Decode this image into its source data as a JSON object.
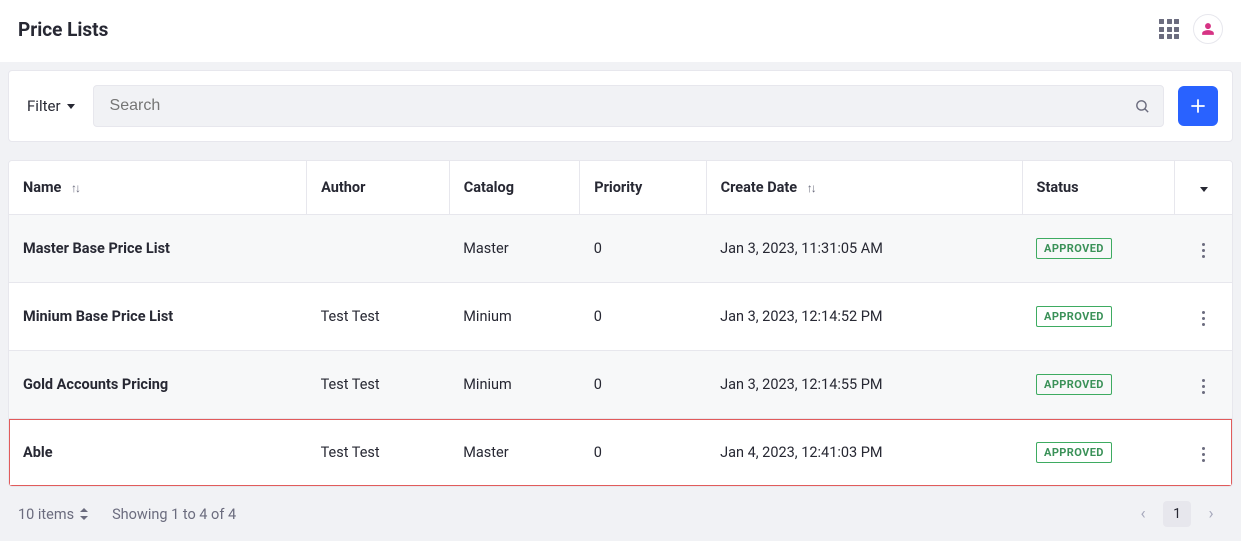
{
  "header": {
    "title": "Price Lists"
  },
  "toolbar": {
    "filter_label": "Filter",
    "search_placeholder": "Search",
    "add_label": "+"
  },
  "table": {
    "columns": {
      "name": "Name",
      "author": "Author",
      "catalog": "Catalog",
      "priority": "Priority",
      "created": "Create Date",
      "status": "Status"
    },
    "rows": [
      {
        "name": "Master Base Price List",
        "author": "",
        "catalog": "Master",
        "priority": "0",
        "created": "Jan 3, 2023, 11:31:05 AM",
        "status": "APPROVED",
        "highlighted": false
      },
      {
        "name": "Minium Base Price List",
        "author": "Test Test",
        "catalog": "Minium",
        "priority": "0",
        "created": "Jan 3, 2023, 12:14:52 PM",
        "status": "APPROVED",
        "highlighted": false
      },
      {
        "name": "Gold Accounts Pricing",
        "author": "Test Test",
        "catalog": "Minium",
        "priority": "0",
        "created": "Jan 3, 2023, 12:14:55 PM",
        "status": "APPROVED",
        "highlighted": false
      },
      {
        "name": "Able",
        "author": "Test Test",
        "catalog": "Master",
        "priority": "0",
        "created": "Jan 4, 2023, 12:41:03 PM",
        "status": "APPROVED",
        "highlighted": true
      }
    ]
  },
  "footer": {
    "items_label": "10 items",
    "showing": "Showing 1 to 4 of 4",
    "current_page": "1"
  }
}
